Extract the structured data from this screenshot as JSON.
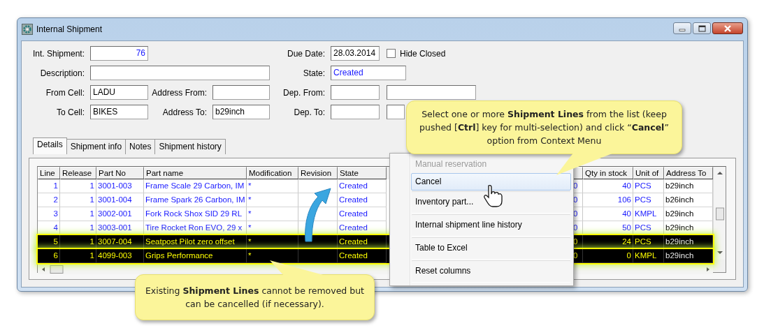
{
  "window": {
    "title": "Internal Shipment"
  },
  "fields": [
    {
      "label": "Int. Shipment:",
      "value": "76",
      "kind": "number"
    },
    {
      "label": "Due Date:",
      "value": "28.03.2014",
      "kind": "text"
    },
    {
      "label": "Hide Closed",
      "kind": "checkbox",
      "checked": false
    },
    {
      "label": "Description:",
      "kind": "text"
    },
    {
      "label": "State:",
      "value": "Created",
      "kind": "status"
    },
    {
      "label": "From Cell:",
      "value": "LADU",
      "kind": "text"
    },
    {
      "label": "Address From:",
      "kind": "text"
    },
    {
      "label": "Dep. From:",
      "kind": "text"
    },
    {
      "kind": "text"
    },
    {
      "label": "To Cell:",
      "value": "BIKES",
      "kind": "text"
    },
    {
      "label": "Address To:",
      "value": "b29inch",
      "kind": "text"
    },
    {
      "label": "Dep. To:",
      "kind": "text"
    },
    {
      "kind": "text"
    }
  ],
  "tabs": [
    {
      "label": "Details",
      "selected": true
    },
    {
      "label": "Shipment info",
      "selected": false
    },
    {
      "label": "Notes",
      "selected": false
    },
    {
      "label": "Shipment history",
      "selected": false
    }
  ],
  "table": {
    "columns": [
      {
        "label": "Line",
        "kind": "number"
      },
      {
        "label": "Release",
        "kind": "number"
      },
      {
        "label": "Part No",
        "kind": "text"
      },
      {
        "label": "Part name",
        "kind": "text"
      },
      {
        "label": "Modification",
        "kind": "text"
      },
      {
        "label": "Revision",
        "kind": "text"
      },
      {
        "label": "State",
        "kind": "text"
      },
      {
        "kind": "text"
      },
      {
        "label": "Qty in stock",
        "kind": "number"
      },
      {
        "label": "Unit of",
        "kind": "text"
      },
      {
        "label": "Address To",
        "kind": "plain"
      }
    ],
    "rows": [
      {
        "selected": false,
        "cells": [
          "1",
          "1",
          "3001-003",
          "Frame Scale 29 Carbon, IM",
          "*",
          null,
          "Created",
          "0",
          "40",
          "PCS",
          "b29inch"
        ]
      },
      {
        "selected": false,
        "cells": [
          "2",
          "1",
          "3001-004",
          "Frame Spark 26 Carbon, IM",
          "*",
          null,
          "Created",
          "0",
          "106",
          "PCS",
          "b26inch"
        ]
      },
      {
        "selected": false,
        "cells": [
          "3",
          "1",
          "3002-001",
          "Fork Rock Shox SID 29 RL",
          "*",
          null,
          "Created",
          "0",
          "40",
          "KMPL",
          "b29inch"
        ]
      },
      {
        "selected": false,
        "cells": [
          "4",
          "1",
          "3003-001",
          "Tire Rocket Ron EVO, 29 x",
          "*",
          null,
          "Created",
          "0",
          "50",
          "PCS",
          "b29inch"
        ]
      },
      {
        "selected": true,
        "cells": [
          "5",
          "1",
          "3007-004",
          "Seatpost Pilot zero offset",
          "*",
          null,
          "Created",
          "0",
          "24",
          "PCS",
          "b29inch"
        ]
      },
      {
        "selected": true,
        "cells": [
          "6",
          "1",
          "4099-003",
          "Grips Performance",
          "*",
          null,
          "Created",
          "0",
          "0",
          "KMPL",
          "b29inch"
        ]
      }
    ]
  },
  "context_menu": {
    "items": [
      {
        "label": "Manual reservation",
        "disabled": true,
        "selected": false
      },
      {
        "label": "Cancel",
        "disabled": false,
        "selected": true
      },
      {
        "label": "Inventory part...",
        "disabled": false,
        "selected": false
      },
      {
        "label": "Internal shipment line history",
        "disabled": false,
        "selected": false
      },
      {
        "label": "Table to Excel",
        "disabled": false,
        "selected": false
      },
      {
        "label": "Reset columns",
        "disabled": false,
        "selected": false
      }
    ]
  },
  "callouts": [
    {
      "text": "Select one or more **Shipment Lines** from the list (keep pushed [**Ctrl**] key for multi-selection) and click “**Cancel**” option from Context Menu"
    },
    {
      "text": "Existing **Shipment Lines** cannot be removed but can be cancelled (if necessary)."
    }
  ]
}
